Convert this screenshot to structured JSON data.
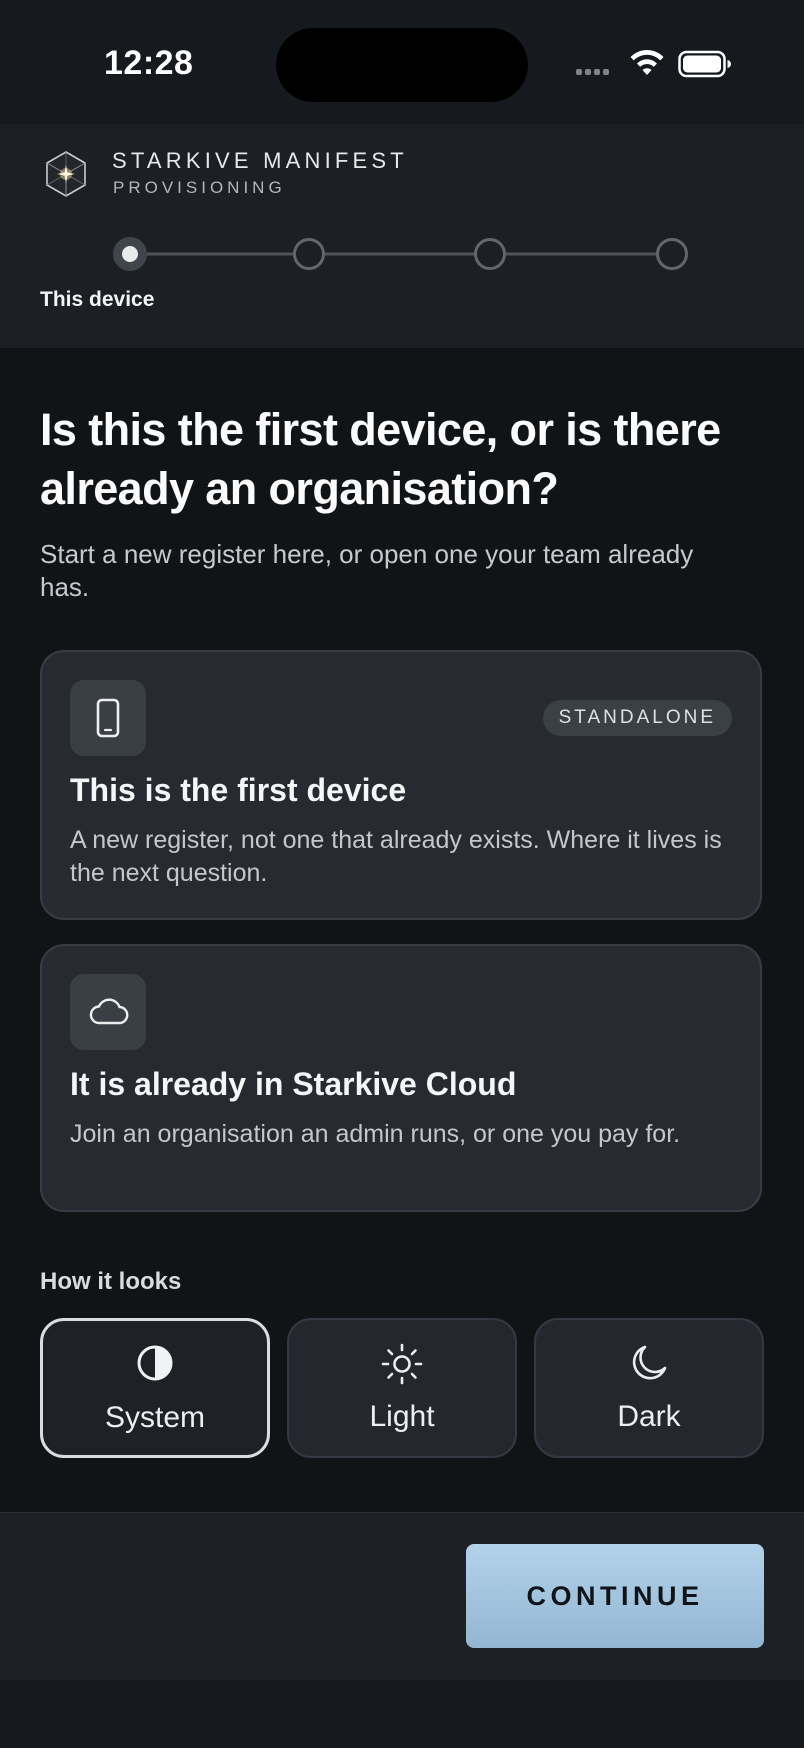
{
  "status_bar": {
    "time": "12:28"
  },
  "header": {
    "brand_title": "STARKIVE MANIFEST",
    "brand_subtitle": "PROVISIONING",
    "steps": [
      {
        "state": "current"
      },
      {
        "state": "upcoming"
      },
      {
        "state": "upcoming"
      },
      {
        "state": "upcoming"
      }
    ],
    "current_step_label": "This device"
  },
  "main": {
    "headline": "Is this the first device, or is there already an organisation?",
    "lede": "Start a new register here, or open one your team already has.",
    "options": [
      {
        "icon": "phone-icon",
        "badge": "STANDALONE",
        "title": "This is the first device",
        "description": "A new register, not one that already exists. Where it lives is the next question."
      },
      {
        "icon": "cloud-icon",
        "title": "It is already in Starkive Cloud",
        "description": "Join an organisation an admin runs, or one you pay for."
      }
    ],
    "appearance": {
      "label": "How it looks",
      "selected": "System",
      "choices": [
        {
          "label": "System",
          "icon": "half-circle-icon"
        },
        {
          "label": "Light",
          "icon": "sun-icon"
        },
        {
          "label": "Dark",
          "icon": "moon-icon"
        }
      ]
    }
  },
  "footer": {
    "continue_label": "CONTINUE"
  },
  "colors": {
    "background": "#111417",
    "card": "#272b31",
    "accent_button": "#a6c7e0"
  }
}
